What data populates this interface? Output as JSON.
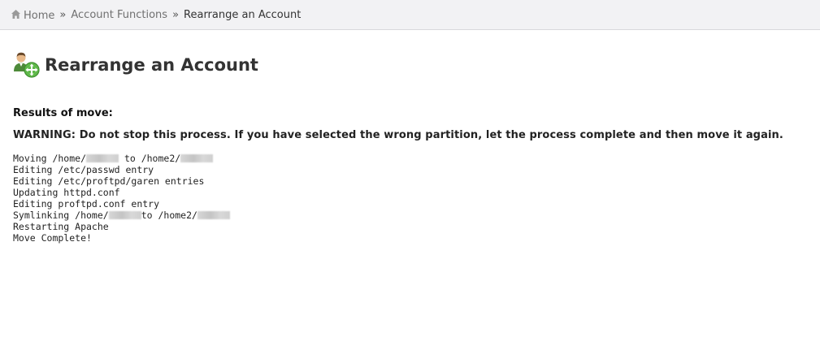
{
  "breadcrumb": {
    "home": "Home",
    "separator": "»",
    "section": "Account Functions",
    "current": "Rearrange an Account"
  },
  "page": {
    "title": "Rearrange an Account",
    "icon": "user-move-icon"
  },
  "results": {
    "heading": "Results of move:",
    "warning": "WARNING: Do not stop this process. If you have selected the wrong partition, let the process complete and then move it again."
  },
  "log": {
    "moving_prefix": "Moving /home/",
    "moving_mid": " to /home2/",
    "editing_passwd": "Editing /etc/passwd entry",
    "editing_proftpd": "Editing /etc/proftpd/garen entries",
    "updating_httpd": "Updating httpd.conf",
    "editing_proftpd_conf": "Editing proftpd.conf entry",
    "symlinking_prefix": "Symlinking /home/",
    "symlinking_mid": "to /home2/",
    "restarting": "Restarting Apache",
    "complete": "Move Complete!"
  }
}
